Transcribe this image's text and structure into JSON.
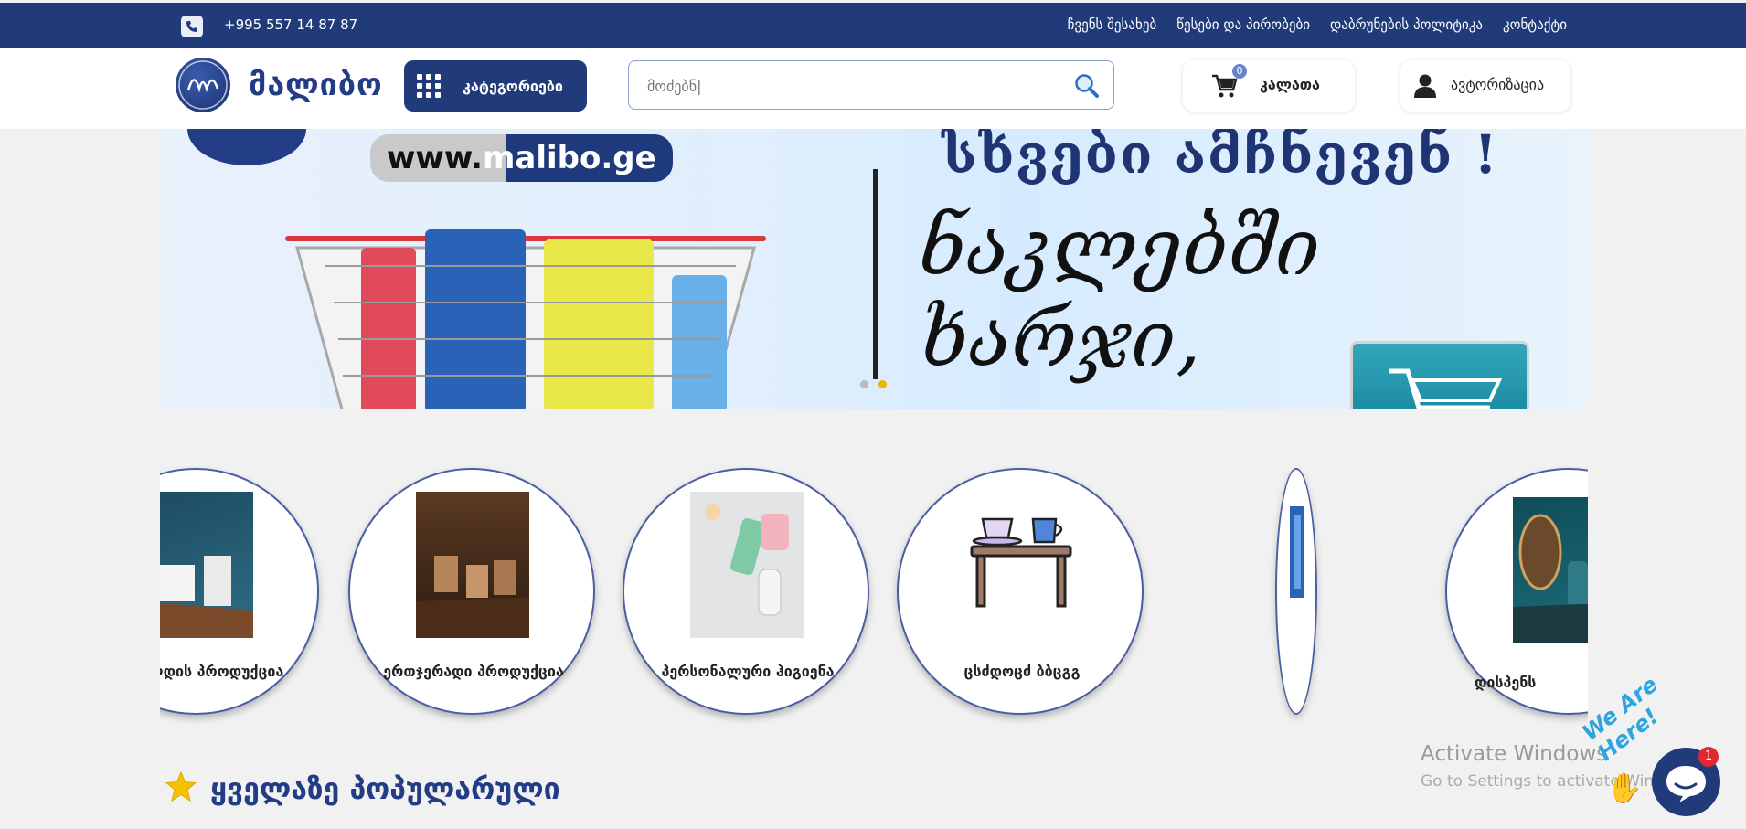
{
  "topbar": {
    "phone": "+995 557 14 87 87",
    "links": [
      "ჩვენს შესახებ",
      "წესები და პირობები",
      "დაბრუნების პოლიტიკა",
      "კონტაქტი"
    ]
  },
  "header": {
    "logo_text": "მალიბო",
    "categories_label": "კატეგორიები",
    "search_placeholder": "მოძებნ|",
    "cart_label": "კალათა",
    "cart_count": "0",
    "auth_label": "ავტორიზაცია"
  },
  "banner": {
    "site": "www.malibo.ge",
    "site_part1": "www.",
    "site_part2": "malibo.ge",
    "headline": "სხვები ამჩნევენ !",
    "script_text": "ნაკლებში ხარჯი,",
    "sign_text": ""
  },
  "categories": [
    {
      "label": "ქაღალდის პროდუქცია"
    },
    {
      "label": "ერთჯერადი პროდუქცია"
    },
    {
      "label": "პერსონალური ჰიგიენა"
    },
    {
      "label": "ცსძდოცძ ბბცგგ"
    },
    {
      "label": "დისპენს"
    }
  ],
  "popular": {
    "title": "ყველაზე პოპულარული"
  },
  "watermark": {
    "line1": "Activate Windows",
    "line2": "Go to Settings to activate Windows."
  },
  "chat": {
    "badge": "1",
    "tagline": "We Are Here!"
  },
  "colors": {
    "brand": "#213a7a",
    "accent_text": "#223c85",
    "badge_red": "#e0282e"
  }
}
